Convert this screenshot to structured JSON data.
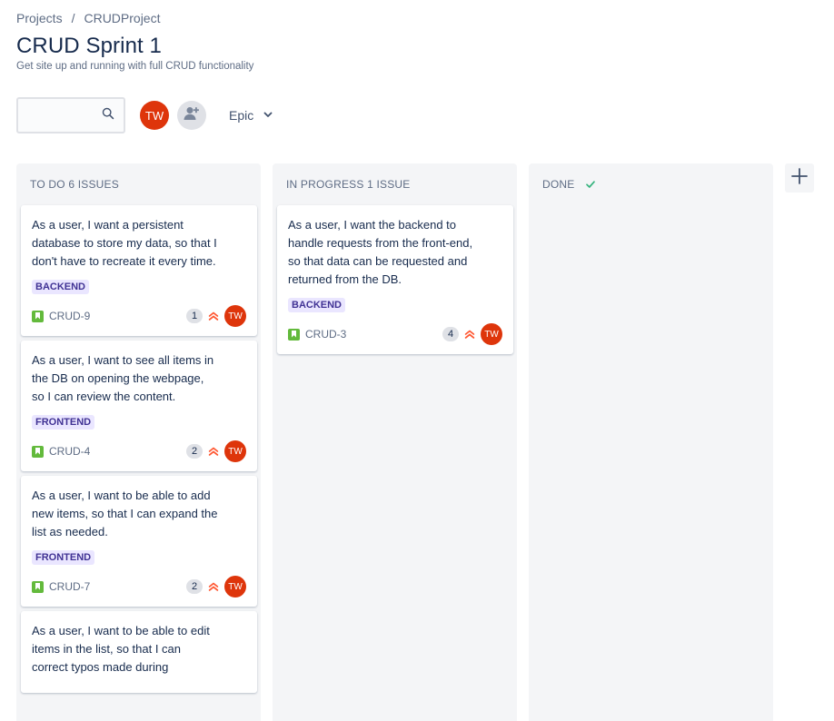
{
  "breadcrumb": {
    "projects": "Projects",
    "separator": "/",
    "project": "CRUDProject"
  },
  "sprint": {
    "title": "CRUD Sprint 1",
    "goal": "Get site up and running with full CRUD functionality"
  },
  "toolbar": {
    "search_value": "",
    "avatar_initials": "TW",
    "epic_label": "Epic"
  },
  "colors": {
    "avatar": "#de350b",
    "story": "#63ba3c",
    "priority": "#ff5630",
    "label_bg": "#eae6ff",
    "label_text": "#403294",
    "done_check": "#36b37e"
  },
  "columns": [
    {
      "title": "TO DO 6 ISSUES",
      "cards": [
        {
          "summary": "As a user, I want a persistent database to store my data, so that I don't have to recreate it every time.",
          "label": "BACKEND",
          "key": "CRUD-9",
          "points": "1",
          "assignee": "TW",
          "priority_icon": "highest-priority-icon"
        },
        {
          "summary": "As a user, I want to see all items in the DB on opening the webpage, so I can review the content.",
          "label": "FRONTEND",
          "key": "CRUD-4",
          "points": "2",
          "assignee": "TW",
          "priority_icon": "highest-priority-icon"
        },
        {
          "summary": "As a user, I want to be able to add new items, so that I can expand the list as needed.",
          "label": "FRONTEND",
          "key": "CRUD-7",
          "points": "2",
          "assignee": "TW",
          "priority_icon": "highest-priority-icon"
        },
        {
          "summary": "As a user, I want to be able to edit items in the list, so that I can correct typos made during",
          "label": "",
          "key": "",
          "points": "",
          "assignee": ""
        }
      ]
    },
    {
      "title": "IN PROGRESS 1 ISSUE",
      "cards": [
        {
          "summary": "As a user, I want the backend to handle requests from the front-end, so that data can be requested and returned from the DB.",
          "label": "BACKEND",
          "key": "CRUD-3",
          "points": "4",
          "assignee": "TW",
          "priority_icon": "highest-priority-icon"
        }
      ]
    },
    {
      "title": "DONE",
      "cards": []
    }
  ]
}
